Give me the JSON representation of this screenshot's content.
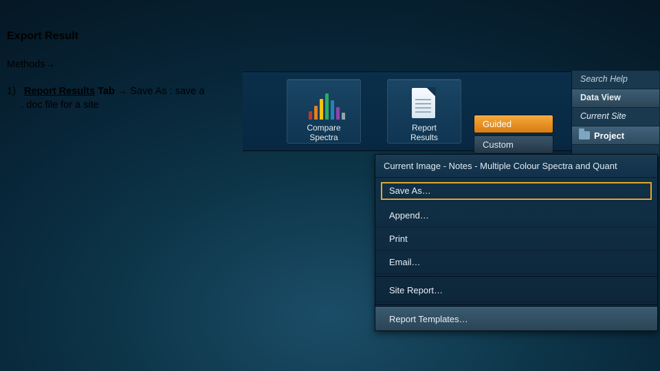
{
  "title": "Export Result",
  "methods_label": "Methods→",
  "bullet": {
    "num": "1)",
    "rr": "Report Results",
    "tab": " Tab ",
    "arrow": "→",
    "rest1": " Save As  : save a",
    "rest2": ". doc file for a site"
  },
  "ribbon": {
    "compare": "Compare\nSpectra",
    "report": "Report\nResults"
  },
  "side": {
    "guided": "Guided",
    "custom": "Custom"
  },
  "tabs": {
    "search": "Search Help",
    "data_view": "Data View",
    "current_site": "Current Site",
    "project": "Project"
  },
  "menu": {
    "header": "Current Image - Notes - Multiple Colour Spectra and Quant",
    "save_as": "Save As…",
    "append": "Append…",
    "print": "Print",
    "email": "Email…",
    "site_report": "Site Report…",
    "templates": "Report Templates…"
  }
}
